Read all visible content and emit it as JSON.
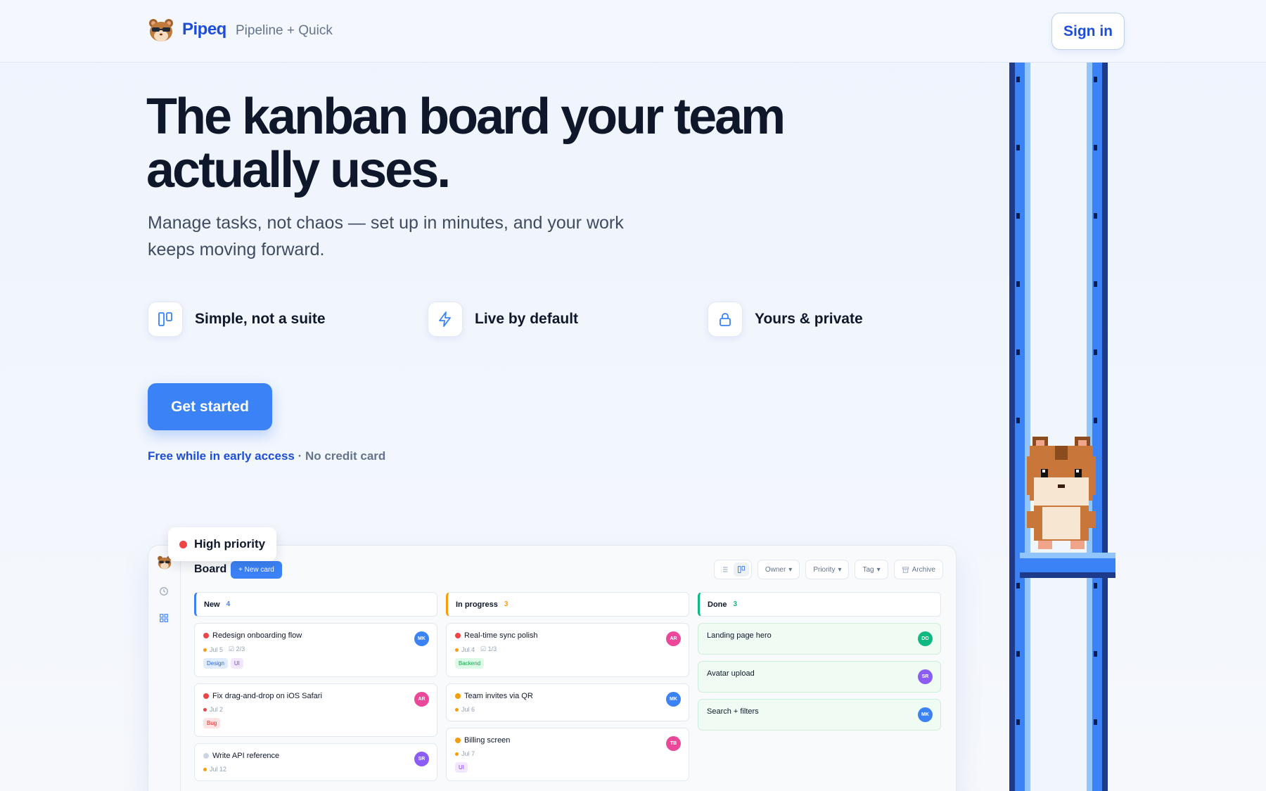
{
  "header": {
    "brand": "Pipeq",
    "tagline": "Pipeline + Quick",
    "signin_label": "Sign in"
  },
  "hero": {
    "headline": "The kanban board your team actually uses.",
    "subhead": "Manage tasks, not chaos — set up in minutes, and your work keeps moving forward.",
    "features": [
      {
        "label": "Simple, not a suite",
        "icon": "board-columns-icon"
      },
      {
        "label": "Live by default",
        "icon": "lightning-icon"
      },
      {
        "label": "Yours & private",
        "icon": "lock-icon"
      }
    ],
    "cta_label": "Get started",
    "note_highlight": "Free while in early access",
    "note_rest": " · No credit card"
  },
  "board": {
    "badge": "High priority",
    "title": "Board",
    "new_card_label": "+ New card",
    "filters": {
      "owner": "Owner",
      "priority": "Priority",
      "tag": "Tag",
      "archive": "Archive"
    },
    "columns": [
      {
        "name": "New",
        "count": "4",
        "color": "#3b82f6"
      },
      {
        "name": "In progress",
        "count": "3",
        "color": "#f59e0b"
      },
      {
        "name": "Done",
        "count": "3",
        "color": "#10b981"
      }
    ],
    "cards": {
      "new": [
        {
          "title": "Redesign onboarding flow",
          "date": "Jul 5",
          "subtasks": "2/3",
          "tags": [
            "Design",
            "UI"
          ],
          "avatar": "MK"
        },
        {
          "title": "Fix drag-and-drop on iOS Safari",
          "date": "Jul 2",
          "tags": [
            "Bug"
          ],
          "avatar": "AR"
        },
        {
          "title": "Write API reference",
          "date": "Jul 12",
          "avatar": "SR"
        }
      ],
      "in_progress": [
        {
          "title": "Real-time sync polish",
          "date": "Jul 4",
          "subtasks": "1/3",
          "tags": [
            "Backend"
          ],
          "avatar": "AR"
        },
        {
          "title": "Team invites via QR",
          "date": "Jul 6",
          "avatar": "MK"
        },
        {
          "title": "Billing screen",
          "date": "Jul 7",
          "tags": [
            "UI"
          ],
          "avatar": "TB"
        }
      ],
      "done": [
        {
          "title": "Landing page hero",
          "avatar": "DO"
        },
        {
          "title": "Avatar upload",
          "avatar": "SR"
        },
        {
          "title": "Search + filters",
          "avatar": "MK"
        }
      ]
    }
  },
  "colors": {
    "accent": "#3b82f6",
    "brand": "#1d4ed8",
    "priority_high": "#ef4444",
    "priority_med": "#f59e0b"
  }
}
